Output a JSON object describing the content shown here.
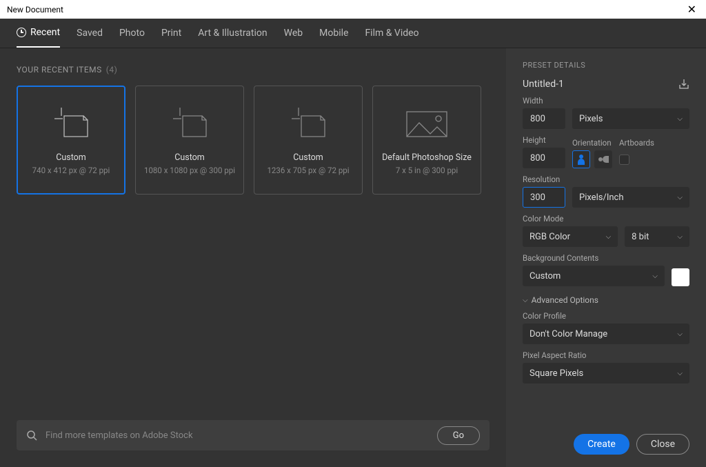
{
  "window": {
    "title": "New Document"
  },
  "tabs": [
    {
      "label": "Recent",
      "active": true
    },
    {
      "label": "Saved"
    },
    {
      "label": "Photo"
    },
    {
      "label": "Print"
    },
    {
      "label": "Art & Illustration"
    },
    {
      "label": "Web"
    },
    {
      "label": "Mobile"
    },
    {
      "label": "Film & Video"
    }
  ],
  "recent": {
    "section_label": "YOUR RECENT ITEMS",
    "count": "(4)",
    "items": [
      {
        "title": "Custom",
        "subtitle": "740 x 412 px @ 72 ppi",
        "selected": true,
        "icon": "page"
      },
      {
        "title": "Custom",
        "subtitle": "1080 x 1080 px @ 300 ppi",
        "icon": "page"
      },
      {
        "title": "Custom",
        "subtitle": "1236 x 705 px @ 72 ppi",
        "icon": "page"
      },
      {
        "title": "Default Photoshop Size",
        "subtitle": "7 x 5 in @ 300 ppi",
        "icon": "image"
      }
    ]
  },
  "search": {
    "placeholder": "Find more templates on Adobe Stock",
    "go": "Go"
  },
  "details": {
    "header": "PRESET DETAILS",
    "name": "Untitled-1",
    "width_label": "Width",
    "width_value": "800",
    "width_unit": "Pixels",
    "height_label": "Height",
    "height_value": "800",
    "orientation_label": "Orientation",
    "artboards_label": "Artboards",
    "resolution_label": "Resolution",
    "resolution_value": "300",
    "resolution_unit": "Pixels/Inch",
    "colormode_label": "Color Mode",
    "colormode_value": "RGB Color",
    "bitdepth_value": "8 bit",
    "bgcontents_label": "Background Contents",
    "bgcontents_value": "Custom",
    "advanced_label": "Advanced Options",
    "colorprofile_label": "Color Profile",
    "colorprofile_value": "Don't Color Manage",
    "par_label": "Pixel Aspect Ratio",
    "par_value": "Square Pixels"
  },
  "buttons": {
    "create": "Create",
    "close": "Close"
  }
}
